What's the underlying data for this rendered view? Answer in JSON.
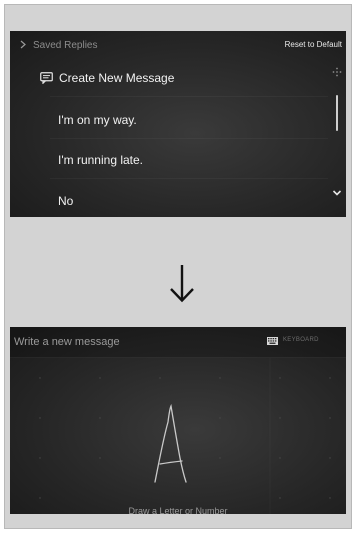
{
  "top_screen": {
    "breadcrumb": "Saved Replies",
    "reset_label": "Reset to Default",
    "items": [
      {
        "label": "Create New Message",
        "icon": "message-icon"
      },
      {
        "label": "I'm on my way."
      },
      {
        "label": "I'm running late."
      },
      {
        "label": "No"
      }
    ],
    "scroll_icons": [
      "drag-handle-icon",
      "chevron-down-icon"
    ]
  },
  "transition_icon": "down-arrow-icon",
  "bottom_screen": {
    "input_placeholder": "Write a new message",
    "keyboard_label": "KEYBOARD",
    "keyboard_icon": "keyboard-icon",
    "handwriting_sample": "A",
    "hint": "Draw a Letter or Number"
  },
  "colors": {
    "frame_background": "#d3d3d3",
    "screen_background": "#262626",
    "primary_text": "#f2f2f2",
    "secondary_text": "#8c8c8c"
  }
}
